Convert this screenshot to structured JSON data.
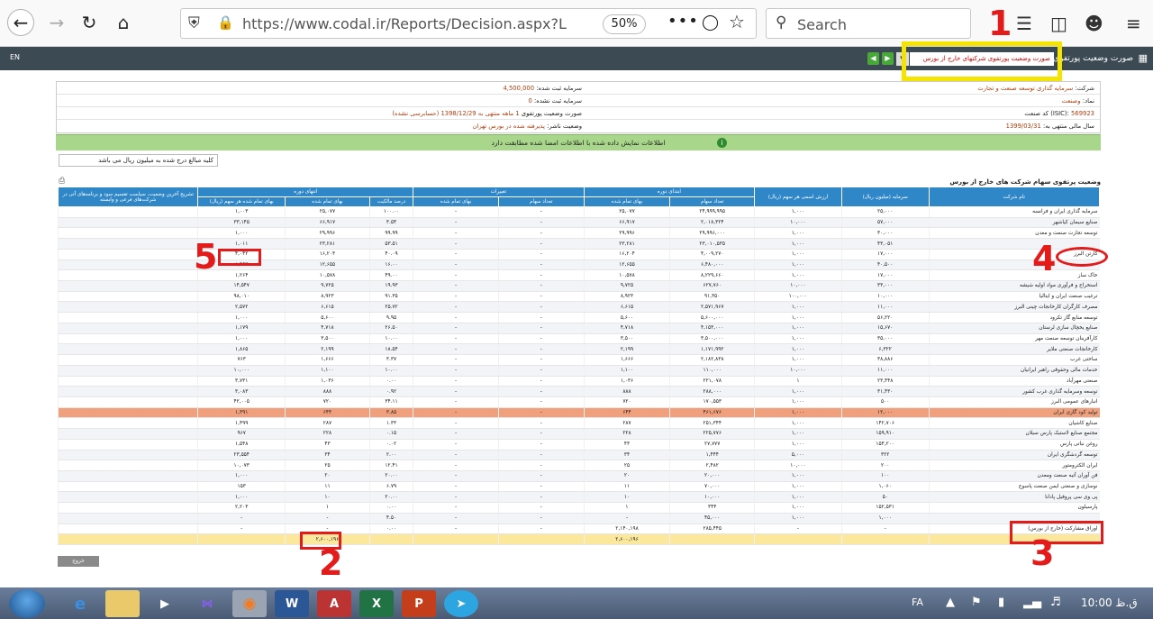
{
  "browser": {
    "url": "https://www.codal.ir/Reports/Decision.aspx?Letter",
    "zoom": "50%",
    "search_placeholder": "Search"
  },
  "site": {
    "lang_toggle": "EN",
    "portfolio_title": "صورت وضعیت پورتفوی",
    "nav_select": "صورت وضعیت پورتفوی شرکتهای خارج از بورس"
  },
  "info": {
    "company_label": "شرکت:",
    "company_value": "سرمایه گذاری توسعه صنعت و تجارت",
    "symbol_label": "نماد:",
    "symbol_value": "وصنعت",
    "isic_label": "کد صنعت (ISIC):",
    "isic_value": "569923",
    "fiscal_label": "سال مالی منتهی به:",
    "fiscal_value": "1399/03/31",
    "capital_label": "سرمایه ثبت شده:",
    "capital_value": "4,500,000",
    "unregistered_label": "سرمایه ثبت نشده:",
    "unregistered_value": "0",
    "period_label": "صورت وضعیت پورتفوی",
    "period_value": "1 ماهه منتهی به 1398/12/29 (حسابرسی نشده)",
    "status_label": "وضعیت ناشر:",
    "status_value": "پذیرفته شده در بورس تهران",
    "green_notice": "اطلاعات نمایش داده شده با اطلاعات امضا شده مطابقت دارد",
    "units_note": "کلیه مبالغ درج شده به میلیون ریال می باشد",
    "table_caption": "وضعیت پرتفوی سهام شرکت های خارج از بورس",
    "back_button": "خروج"
  },
  "table": {
    "group_headers": {
      "start": "ابتدای دوره",
      "changes": "تغییرات",
      "end": "انتهای دوره"
    },
    "columns": {
      "name": "نام شرکت",
      "capital": "سرمایه (میلیون ریال)",
      "nominal": "ارزش اسمی هر سهم (ریال)",
      "start_shares": "تعداد سهام",
      "start_cost": "بهای تمام شده",
      "chg_shares": "تعداد سهام",
      "chg_cost": "بهای تمام شده",
      "end_pct": "درصد مالکیت",
      "end_cost": "بهای تمام شده",
      "end_cost_per": "بهای تمام شده هر سهم (ریال)",
      "explain": "تشریح آخرین وضعیت، سیاست تقسیم سود و برنامه‌های آتی در شرکت‌های فرعی و وابسته"
    },
    "rows": [
      [
        "سرمایه گذاری ایران و فرانسه",
        "۲۵,۰۰۰",
        "۱,۰۰۰",
        "۲۴,۹۹۹,۹۹۵",
        "۲۵,۰۷۷",
        "-",
        "-",
        "۱۰۰.۰۰",
        "۲۵,۰۷۷",
        "۱,۰۰۳",
        ""
      ],
      [
        "صنایع سیمان کیاشهر",
        "۵۷,۰۰۰",
        "۱۰,۰۰۰",
        "۲,۰۱۸,۳۲۴",
        "۶۶,۹۱۷",
        "-",
        "-",
        "۳.۵۴",
        "۶۶,۹۱۷",
        "۳۳,۱۴۵",
        ""
      ],
      [
        "توسعه تجارت صنعت و معدن",
        "۳۰,۰۰۰",
        "۱,۰۰۰",
        "۲۹,۹۹۶,۰۰۰",
        "۲۹,۹۹۶",
        "-",
        "-",
        "۹۹.۹۹",
        "۲۹,۹۹۶",
        "۱,۰۰۰",
        ""
      ],
      [
        "",
        "۴۳,۰۵۱",
        "۱,۰۰۰",
        "۲۳,۰۱۰,۵۳۵",
        "۲۳,۲۸۱",
        "-",
        "-",
        "۵۳.۵۱",
        "۲۳,۲۸۱",
        "۱,۰۱۱",
        ""
      ],
      [
        "کارتن البرز",
        "۱۷,۰۰۰",
        "۱,۰۰۰",
        "۴,۰۰۹,۲۷۰",
        "۱۶,۲۰۴",
        "-",
        "-",
        "۴۰.۰۹",
        "۱۶,۲۰۴",
        "۴,۰۴۲",
        ""
      ],
      [
        "",
        "۴۰,۵۰۰",
        "۱,۰۰۰",
        "۶,۴۸۰,۰۰۰",
        "۱۲,۶۵۵",
        "-",
        "-",
        "۱۶.۰۰",
        "۱۲,۶۵۵",
        "۱,۹۵۳",
        ""
      ],
      [
        "خاک ساز",
        "۱۷,۰۰۰",
        "۱,۰۰۰",
        "۸,۲۲۹,۶۶۰",
        "۱۰,۵۷۸",
        "-",
        "-",
        "۴۹.۰۰",
        "۱۰,۵۷۸",
        "۱,۲۶۴",
        ""
      ],
      [
        "استخراج و فرآوری مواد اولیه شیشه",
        "۳۳,۰۰۰",
        "۱۰,۰۰۰",
        "۶۲۷,۷۶۰",
        "۹,۷۲۵",
        "-",
        "-",
        "۱۹.۹۳",
        "۹,۷۲۵",
        "۱۴,۵۴۷",
        ""
      ],
      [
        "ترغیب صنعت ایران و ایتالیا",
        "۱۰,۰۰۰",
        "۱۰۰,۰۰۰",
        "۹۱,۳۵۰",
        "۸,۹۲۳",
        "-",
        "-",
        "۹۱.۳۵",
        "۸,۹۲۳",
        "۹۸,۰۱۰",
        ""
      ],
      [
        "مصرف کارگران کارخانجات چینی البرز",
        "۱۱,۰۰۰",
        "۱,۰۰۰",
        "۲,۵۷۱,۹۶۷",
        "۶,۶۱۵",
        "-",
        "-",
        "۲۵.۷۲",
        "۶,۶۱۵",
        "۲,۵۷۲",
        ""
      ],
      [
        "توسعه منابع گاز تکرود",
        "۵۶,۲۲۰",
        "۱,۰۰۰",
        "۵,۶۰۰,۰۰۰",
        "۵,۶۰۰",
        "-",
        "-",
        "۹.۹۵",
        "۵,۶۰۰",
        "۱,۰۰۰",
        ""
      ],
      [
        "صنایع یخچال سازی لرستان",
        "۱۵,۶۷۰",
        "۱,۰۰۰",
        "۴,۱۵۳,۰۰۰",
        "۴,۷۱۸",
        "-",
        "-",
        "۲۶.۵۰",
        "۴,۷۱۸",
        "۱,۱۷۹",
        ""
      ],
      [
        "کارآفرینان توسعه صنعت مهر",
        "۳۵,۰۰۰",
        "۱,۰۰۰",
        "۳,۵۰۰,۰۰۰",
        "۳,۵۰۰",
        "-",
        "-",
        "۱۰.۰۰",
        "۳,۵۰۰",
        "۱,۰۰۰",
        ""
      ],
      [
        "کارخانجات صنعتی ملایر",
        "۶,۳۲۲",
        "۱,۰۰۰",
        "۱,۱۷۱,۹۹۲",
        "۲,۱۹۹",
        "-",
        "-",
        "۱۸.۵۴",
        "۲,۱۹۹",
        "۱,۸۶۵",
        ""
      ],
      [
        "ساختی غرب",
        "۳۸,۸۸۶",
        "۱,۰۰۰",
        "۲,۱۸۲,۸۳۸",
        "۱,۶۶۶",
        "-",
        "-",
        "۳.۳۷",
        "۱,۶۶۶",
        "۷۶۳",
        ""
      ],
      [
        "خدمات مالی وحقوقی راهبر ایرانیان",
        "۱۱,۰۰۰",
        "۱۰,۰۰۰",
        "۱۱۰,۰۰۰",
        "۱,۱۰۰",
        "-",
        "-",
        "۱۰.۰۰",
        "۱,۱۰۰",
        "۱۰,۰۰۰",
        ""
      ],
      [
        "صنعتی مهرآباد",
        "۲۳,۴۴۸",
        "۱",
        "۲۲۱,۰۷۸",
        "۱,۰۳۶",
        "-",
        "-",
        "۰.۰۰",
        "۱,۰۳۶",
        "۳,۷۳۱",
        ""
      ],
      [
        "توسعه وسرمایه گذاری غرب کشور",
        "۳۱,۴۳۰",
        "۱,۰۰۰",
        "۲۸۸,۰۰۰",
        "۸۸۸",
        "-",
        "-",
        "۰.۹۲",
        "۸۸۸",
        "۳,۰۸۳",
        ""
      ],
      [
        "انبارهای عمومی البرز",
        "۵۰۰",
        "۱,۰۰۰",
        "۱۷۰,۵۵۳",
        "۷۲۰",
        "-",
        "-",
        "۳۴.۱۱",
        "۷۲۰",
        "۴۲,۰۰۵",
        ""
      ],
      [
        "تولید کود گازی ایران",
        "۱۲,۰۰۰",
        "۱,۰۰۰",
        "۴۶۱,۶۷۶",
        "۶۴۴",
        "-",
        "-",
        "۳.۸۵",
        "۶۴۴",
        "۱,۳۹۱",
        ""
      ],
      [
        "صنایع کاشیان",
        "۱۴۲,۷۰۶",
        "۱,۰۰۰",
        "۲۵۱,۳۴۴",
        "۲۸۷",
        "-",
        "-",
        "۱.۳۳",
        "۲۸۷",
        "۱,۴۹۹",
        ""
      ],
      [
        "مجتمع صنایع لاستیک پارس سیلان",
        "۱۵۹,۹۱۰",
        "۱,۰۰۰",
        "۲۲۵,۷۷۶",
        "۲۲۸",
        "-",
        "-",
        "۰.۱۵",
        "۲۲۸",
        "۹۶۷",
        ""
      ],
      [
        "روغن نباتی پارس",
        "۱۵۴,۲۰۰",
        "۱,۰۰۰",
        "۲۷,۷۷۷",
        "۴۳",
        "-",
        "-",
        "۰.۰۲",
        "۴۳",
        "۱,۵۴۸",
        ""
      ],
      [
        "توسعه گردشگری ایران",
        "۳۲۲",
        "۵,۰۰۰",
        "۱,۴۴۴",
        "۳۴",
        "-",
        "-",
        "۲.۰۰",
        "۳۴",
        "۲۳,۵۵۴",
        ""
      ],
      [
        "ایران الکترومتور",
        "۲۰۰",
        "۱۰,۰۰۰",
        "۲,۴۸۲",
        "۲۵",
        "-",
        "-",
        "۱۲.۴۱",
        "۲۵",
        "۱۰,۰۷۳",
        ""
      ],
      [
        "فن آوران آتیه صنعت ومعدن",
        "۱۰۰",
        "۱,۰۰۰",
        "۲۰,۰۰۰",
        "۲۰",
        "-",
        "-",
        "۲۰.۰۰",
        "۲۰",
        "۱,۰۰۰",
        ""
      ],
      [
        "نوسازی و صنعتی ایمن صنعت پاسوج",
        "۱,۰۶۰",
        "۱,۰۰۰",
        "۷۰,۰۰۰",
        "۱۱",
        "-",
        "-",
        "۶.۷۹",
        "۱۱",
        "۱۵۳",
        ""
      ],
      [
        "پی وی سی پروفیل پادانا",
        "۵۰",
        "۱,۰۰۰",
        "۱۰,۰۰۰",
        "۱۰",
        "-",
        "-",
        "۲۰.۰۰",
        "۱۰",
        "۱,۰۰۰",
        ""
      ],
      [
        "پارسیلون",
        "۱۵۲,۵۳۱",
        "۱,۰۰۰",
        "۳۴۴",
        "۱",
        "-",
        "-",
        "۰.۰۰",
        "۱",
        "۲,۲۰۳",
        ""
      ],
      [
        "",
        "۱,۰۰۰",
        "۱,۰۰۰",
        "۴۵,۰۰۰",
        "-",
        "-",
        "-",
        "۴.۵۰",
        "-",
        "-",
        ""
      ],
      [
        "اوراق مشارکت (خارج از بورس)",
        "-",
        "-",
        "۲۸۵,۴۴۵",
        "۲,۱۴۰,۱۹۸",
        "-",
        "-",
        "۰.۰۰",
        "-",
        "-",
        ""
      ]
    ],
    "total_row": [
      "",
      "",
      "",
      "",
      "۲,۶۰۰,۱۹۶",
      "",
      "",
      "",
      "۲,۶۰۰,۱۹۶",
      "",
      ""
    ]
  },
  "annotations": {
    "labels": [
      "1",
      "2",
      "3",
      "4",
      "5"
    ],
    "color": "#e31b1b",
    "highlight_color": "#f5e400"
  },
  "taskbar": {
    "lang": "FA",
    "clock": "10:00 ق.ظ"
  }
}
